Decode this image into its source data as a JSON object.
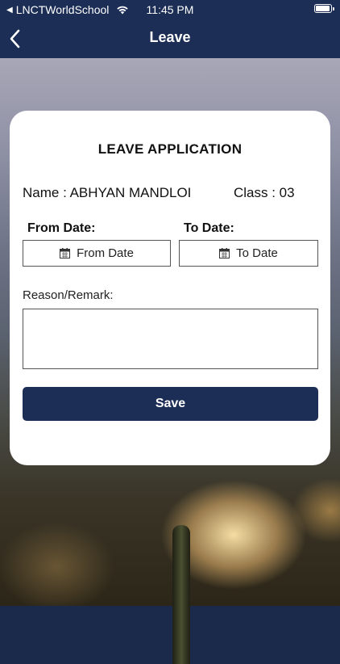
{
  "status_bar": {
    "carrier": "LNCTWorldSchool",
    "time": "11:45 PM",
    "battery_level": 0.95
  },
  "nav": {
    "title": "Leave",
    "back_icon": "chevron-left-icon"
  },
  "form": {
    "title": "LEAVE APPLICATION",
    "name_text": "Name : ABHYAN MANDLOI",
    "class_text": "Class : 03",
    "from_label": "From Date:",
    "to_label": "To Date:",
    "from_button": "From Date",
    "to_button": "To Date",
    "reason_label": "Reason/Remark:",
    "reason_value": "",
    "save_label": "Save"
  },
  "colors": {
    "primary": "#1c2e55",
    "card": "#ffffff"
  }
}
